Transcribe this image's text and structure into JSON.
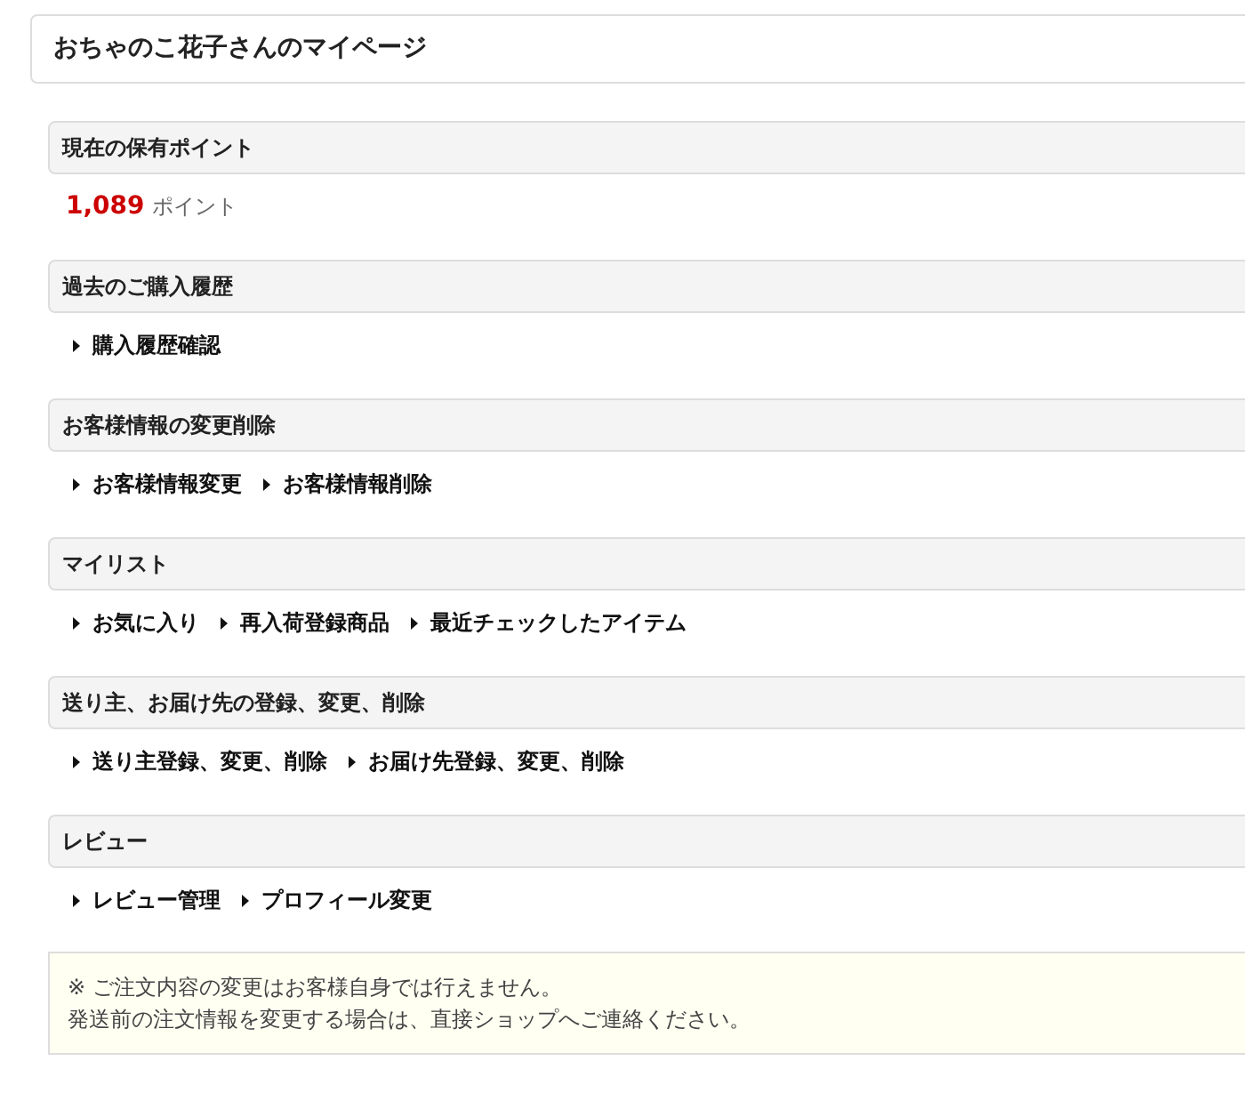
{
  "page_title": "おちゃのこ花子さんのマイページ",
  "points": {
    "heading": "現在の保有ポイント",
    "value": "1,089",
    "unit": "ポイント"
  },
  "sections": [
    {
      "heading": "過去のご購入履歴",
      "links": [
        "購入履歴確認"
      ]
    },
    {
      "heading": "お客様情報の変更削除",
      "links": [
        "お客様情報変更",
        "お客様情報削除"
      ]
    },
    {
      "heading": "マイリスト",
      "links": [
        "お気に入り",
        "再入荷登録商品",
        "最近チェックしたアイテム"
      ]
    },
    {
      "heading": "送り主、お届け先の登録、変更、削除",
      "links": [
        "送り主登録、変更、削除",
        "お届け先登録、変更、削除"
      ]
    },
    {
      "heading": "レビュー",
      "links": [
        "レビュー管理",
        "プロフィール変更"
      ]
    }
  ],
  "notice": [
    "※ ご注文内容の変更はお客様自身では行えません。",
    "発送前の注文情報を変更する場合は、直接ショップへご連絡ください。"
  ]
}
